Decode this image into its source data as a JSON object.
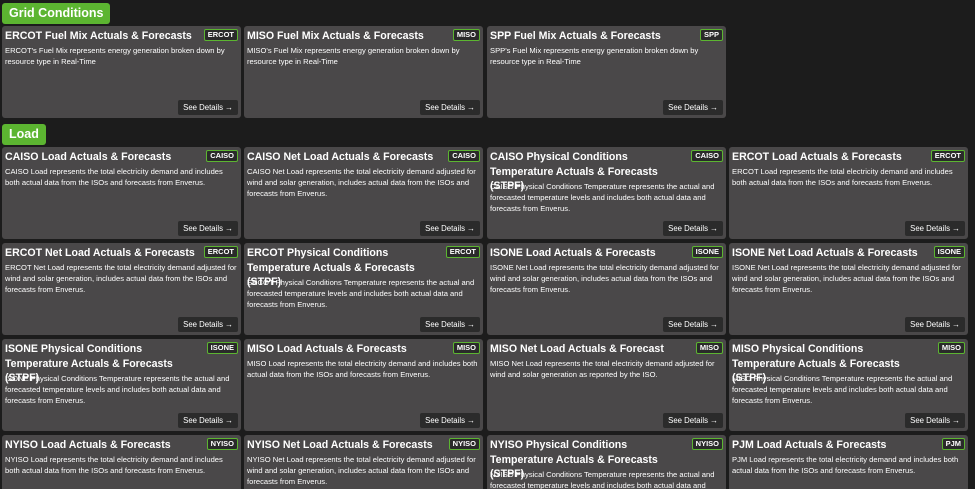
{
  "sections": {
    "grid_conditions": "Grid Conditions",
    "load": "Load"
  },
  "see_details_label": "See Details",
  "arrow_glyph": "→",
  "cards": [
    {
      "title": "ERCOT Fuel Mix Actuals & Forecasts",
      "badge": "ERCOT",
      "desc": "ERCOT's Fuel Mix represents energy generation broken down by resource type in Real-Time"
    },
    {
      "title": "MISO Fuel Mix Actuals & Forecasts",
      "badge": "MISO",
      "desc": "MISO's Fuel Mix represents energy generation broken down by resource type in Real-Time"
    },
    {
      "title": "SPP Fuel Mix Actuals & Forecasts",
      "badge": "SPP",
      "desc": "SPP's Fuel Mix represents energy generation broken down by resource type in Real-Time"
    },
    {
      "title": "CAISO Load Actuals & Forecasts",
      "badge": "CAISO",
      "desc": "CAISO Load represents the total electricity demand and includes both actual data from the ISOs and forecasts from Enverus."
    },
    {
      "title": "CAISO Net Load Actuals & Forecasts",
      "badge": "CAISO",
      "desc": "CAISO Net Load represents the total electricity demand adjusted for wind and solar generation, includes actual data from the ISOs and forecasts from Enverus."
    },
    {
      "title": "CAISO Physical Conditions Temperature Actuals & Forecasts (STPF)",
      "badge": "CAISO",
      "desc": "CAISO Physical Conditions Temperature represents the actual and forecasted temperature levels and includes both actual data and forecasts from Enverus."
    },
    {
      "title": "ERCOT Load Actuals & Forecasts",
      "badge": "ERCOT",
      "desc": "ERCOT Load represents the total electricity demand and includes both actual data from the ISOs and forecasts from Enverus."
    },
    {
      "title": "ERCOT Net Load Actuals & Forecasts",
      "badge": "ERCOT",
      "desc": "ERCOT Net Load represents the total electricity demand adjusted for wind and solar generation, includes actual data from the ISOs and forecasts from Enverus."
    },
    {
      "title": "ERCOT Physical Conditions Temperature Actuals & Forecasts (STPF)",
      "badge": "ERCOT",
      "desc": "ERCOT Physical Conditions Temperature represents the actual and forecasted temperature levels and includes both actual data and forecasts from Enverus."
    },
    {
      "title": "ISONE Load Actuals & Forecasts",
      "badge": "ISONE",
      "desc": "ISONE Net Load represents the total electricity demand adjusted for wind and solar generation, includes actual data from the ISOs and forecasts from Enverus."
    },
    {
      "title": "ISONE Net Load Actuals & Forecasts",
      "badge": "ISONE",
      "desc": "ISONE Net Load represents the total electricity demand adjusted for wind and solar generation, includes actual data from the ISOs and forecasts from Enverus."
    },
    {
      "title": "ISONE Physical Conditions Temperature Actuals & Forecasts (STPF)",
      "badge": "ISONE",
      "desc": "ISONE Physical Conditions Temperature represents the actual and forecasted temperature levels and includes both actual data and forecasts from Enverus."
    },
    {
      "title": "MISO Load Actuals & Forecasts",
      "badge": "MISO",
      "desc": "MISO Load represents the total electricity demand and includes both actual data from the ISOs and forecasts from Enverus."
    },
    {
      "title": "MISO Net Load Actuals & Forecast",
      "badge": "MISO",
      "desc": "MISO Net Load represents the total electricity demand adjusted for wind and solar generation as reported by the ISO."
    },
    {
      "title": "MISO Physical Conditions Temperature Actuals & Forecasts (STPF)",
      "badge": "MISO",
      "desc": "MISO Physical Conditions Temperature represents the actual and forecasted temperature levels and includes both actual data and forecasts from Enverus."
    },
    {
      "title": "NYISO Load Actuals & Forecasts",
      "badge": "NYISO",
      "desc": "NYISO Load represents the total electricity demand and includes both actual data from the ISOs and forecasts from Enverus."
    },
    {
      "title": "NYISO Net Load Actuals & Forecasts",
      "badge": "NYISO",
      "desc": "NYISO Net Load represents the total electricity demand adjusted for wind and solar generation, includes actual data from the ISOs and forecasts from Enverus."
    },
    {
      "title": "NYISO Physical Conditions Temperature Actuals & Forecasts (STPF)",
      "badge": "NYISO",
      "desc": "NYISO Physical Conditions Temperature represents the actual and forecasted temperature levels and includes both actual data and"
    },
    {
      "title": "PJM Load Actuals & Forecasts",
      "badge": "PJM",
      "desc": "PJM Load represents the total electricity demand and includes both actual data from the ISOs and forecasts from Enverus."
    }
  ]
}
